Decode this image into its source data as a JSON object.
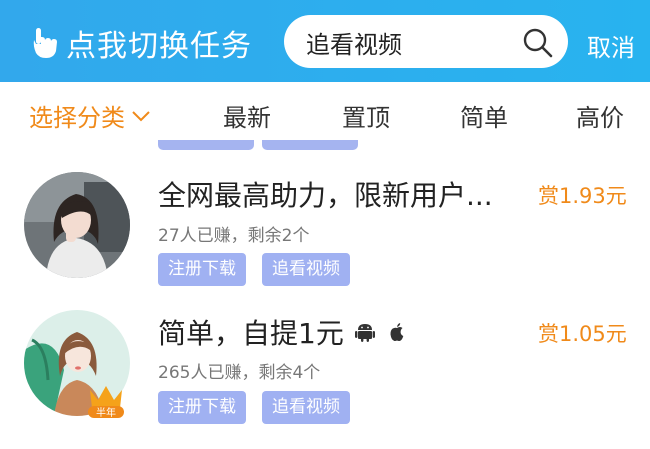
{
  "header": {
    "switch_label": "点我切换任务",
    "search_value": "追看视频",
    "cancel_label": "取消"
  },
  "tabs": [
    {
      "label": "选择分类"
    },
    {
      "label": "最新"
    },
    {
      "label": "置顶"
    },
    {
      "label": "简单"
    },
    {
      "label": "高价"
    }
  ],
  "tasks": [
    {
      "title": "全网最高助力，限新用户...",
      "reward": "赏1.93元",
      "meta": "27人已赚，剩余2个",
      "tags": [
        "注册下载",
        "追看视频"
      ]
    },
    {
      "title": "简单，自提1元",
      "reward": "赏1.05元",
      "meta": "265人已赚，剩余4个",
      "tags": [
        "注册下载",
        "追看视频"
      ],
      "platform_icons": [
        "android-icon",
        "apple-icon"
      ],
      "badge": "半年"
    }
  ],
  "colors": {
    "header": "#2eaced",
    "accent": "#f08a1a",
    "tag_bg": "#a0b1f2"
  }
}
